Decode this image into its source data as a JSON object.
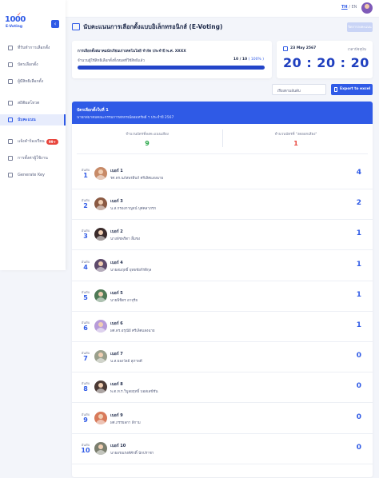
{
  "app": {
    "logo_main": "1000",
    "logo_sub": "E-Voting",
    "lang_th": "TH",
    "lang_sep": "/",
    "lang_en": "EN"
  },
  "sidebar": {
    "items": [
      {
        "label": "ที่รับทำการเลือกตั้ง",
        "icon": "home-icon"
      },
      {
        "label": "บัตรเลือกตั้ง",
        "icon": "ballot-icon"
      },
      {
        "label": "ผู้มีสิทธิเลือกตั้ง",
        "icon": "users-icon"
      },
      {
        "label": "สถิติผลโหวต",
        "icon": "chart-icon"
      },
      {
        "label": "นับคะแนน",
        "icon": "count-icon",
        "active": true
      },
      {
        "label": "แจ้งคำร้องเรียน",
        "icon": "complaint-icon",
        "badge": "99+"
      },
      {
        "label": "การตั้งค่าผู้ใช้งาน",
        "icon": "settings-icon"
      },
      {
        "label": "Generate Key",
        "icon": "key-icon"
      }
    ]
  },
  "header": {
    "title": "นับคะแนนการเลือกตั้งแบบอิเล็กทรอนิกส์ (E-Voting)",
    "action_label": "ปิดการลงคะแนน"
  },
  "election": {
    "title": "การเลือกตั้งสมาคมนักเรียนเก่าเทคโนโลยี จำกัด ประจำปี พ.ศ. XXXX",
    "voter_label": "จำนวนผู้ใช้สิทธิเลือกตั้งทั้งหมดที่ใช้สิทธิแล้ว",
    "voter_count": "10 / 10",
    "voter_percent": "( 100% )",
    "progress": 1.0
  },
  "clock": {
    "date": "23 May 2567",
    "label": "เวลาปัจจุบัน",
    "time": "20 : 20 : 20"
  },
  "filters": {
    "sort_label": "เรียงตามอันดับ",
    "export_label": "Export to excel"
  },
  "ballot": {
    "title": "บัตรเลือกตั้งใบที่ 1",
    "subtitle": "นายกสมาคมคณะกรรมการสหกรณ์ออมทรัพย์ ฯ ประจำปี 2567",
    "stat_left_label": "จำนวนบัตรที่ลงคะแนนเสียง",
    "stat_left_value": "9",
    "stat_right_label": "จำนวนบัตรที่ \"งดออกเสียง\"",
    "stat_right_value": "1"
  },
  "colors": {
    "accent": "#2f5ae6",
    "stat_green": "#2aa84a",
    "stat_red": "#e8453c"
  },
  "candidates": [
    {
      "rank_label": "อันดับ",
      "rank": "1",
      "number": "เบอร์ 1",
      "name": "รศ.ดร.นภัสพรสินก์ ศรีเลิศแสงฉาย",
      "votes": "4",
      "avatar_color": "#c78a67"
    },
    {
      "rank_label": "อันดับ",
      "rank": "2",
      "number": "เบอร์ 3",
      "name": "น.ส.กรองกาญจน์ บุศคลาภรก",
      "votes": "2",
      "avatar_color": "#8b5a43"
    },
    {
      "rank_label": "อันดับ",
      "rank": "3",
      "number": "เบอร์ 2",
      "name": "นางพัชพริดา ลิ้มชง",
      "votes": "1",
      "avatar_color": "#3a2b2b"
    },
    {
      "rank_label": "อันดับ",
      "rank": "4",
      "number": "เบอร์ 4",
      "name": "นายสมฤทธิ์ ยุทธชัยกีรติกุล",
      "votes": "1",
      "avatar_color": "#5d4a6b"
    },
    {
      "rank_label": "อันดับ",
      "rank": "5",
      "number": "เบอร์ 5",
      "name": "นายพิชิตร อาจุรีย",
      "votes": "1",
      "avatar_color": "#4f7a56"
    },
    {
      "rank_label": "อันดับ",
      "rank": "6",
      "number": "เบอร์ 6",
      "name": "ผศ.ดร.อรุณีย์ ศรีเลิศแสงฉาย",
      "votes": "1",
      "avatar_color": "#b79bd9"
    },
    {
      "rank_label": "อันดับ",
      "rank": "7",
      "number": "เบอร์ 7",
      "name": "น.ส.ยองวัลย์ สุภาพดี",
      "votes": "0",
      "avatar_color": "#9aa08c"
    },
    {
      "rank_label": "อันดับ",
      "rank": "8",
      "number": "เบอร์ 8",
      "name": "พ.ต.ท.ร.วิบูลยฤทธิ์ บอสเลข์ชัน",
      "votes": "0",
      "avatar_color": "#4b3a35"
    },
    {
      "rank_label": "อันดับ",
      "rank": "9",
      "number": "เบอร์ 9",
      "name": "ผศ.ภรรยลกา ลีกาม",
      "votes": "0",
      "avatar_color": "#d87a5a"
    },
    {
      "rank_label": "อันดับ",
      "rank": "10",
      "number": "เบอร์ 10",
      "name": "นายอรณรงค์ศักดิ์ นักปราชา",
      "votes": "0",
      "avatar_color": "#7a7e6e"
    }
  ]
}
